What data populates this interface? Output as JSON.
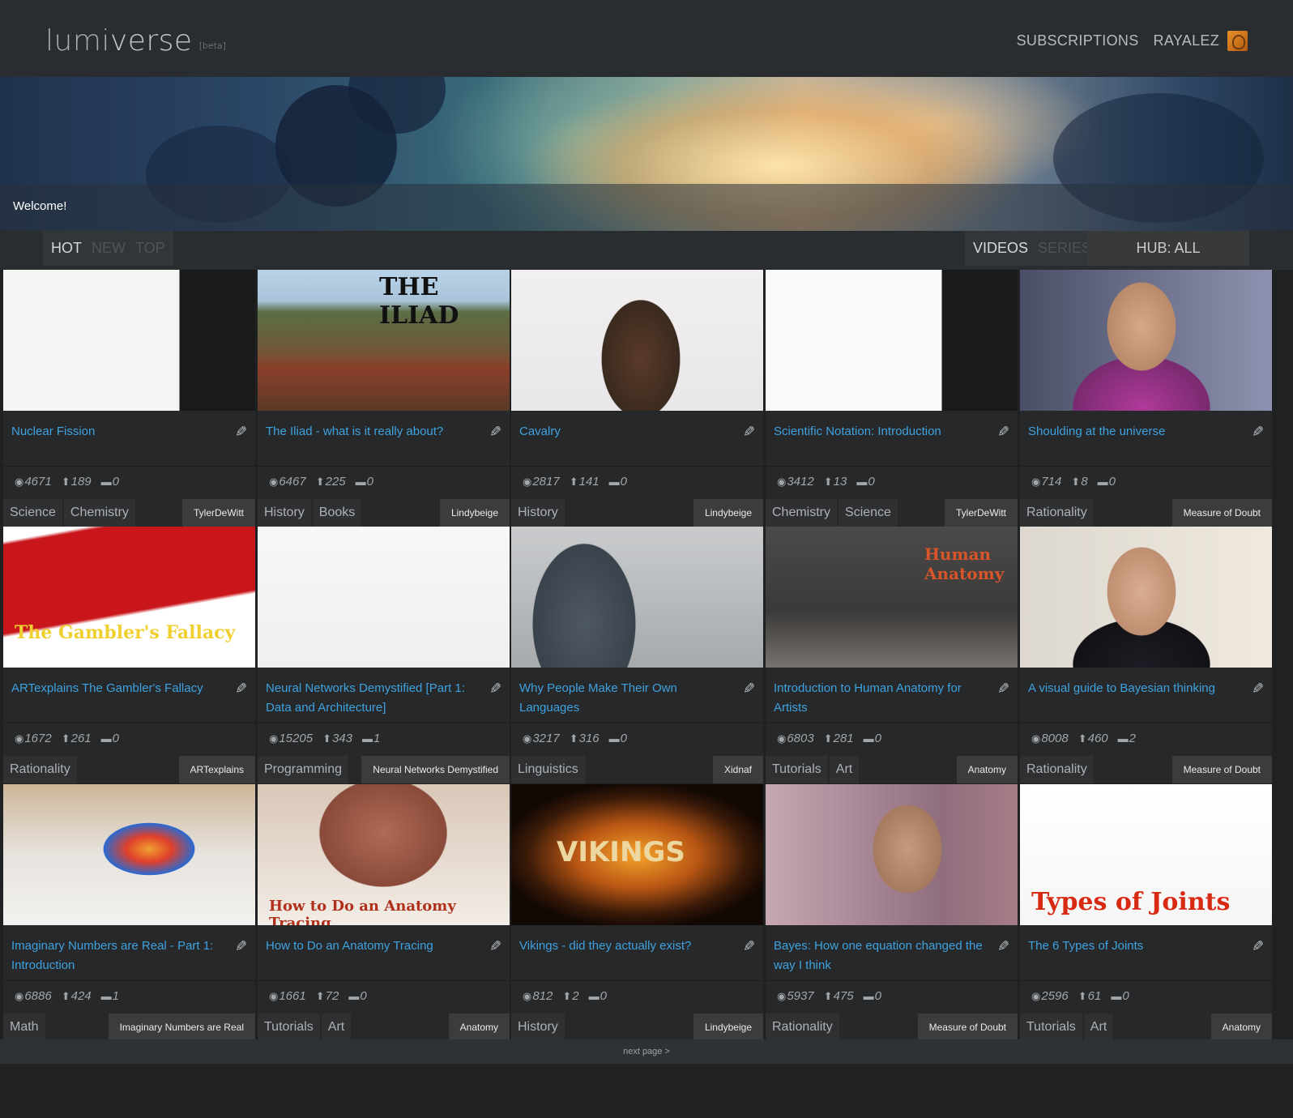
{
  "app": {
    "name_light": "lumi",
    "name_bold": "verse",
    "beta": "[beta]"
  },
  "nav": {
    "subscriptions": "SUBSCRIPTIONS",
    "user": "RAYALEZ"
  },
  "banner": {
    "welcome": "Welcome!"
  },
  "sort_tabs": [
    {
      "label": "HOT",
      "active": true
    },
    {
      "label": "NEW",
      "active": false
    },
    {
      "label": "TOP",
      "active": false
    }
  ],
  "type_tabs": [
    {
      "label": "VIDEOS",
      "active": true
    },
    {
      "label": "SERIES",
      "active": false
    }
  ],
  "hub": {
    "label": "HUB: ALL"
  },
  "colors": {
    "accent_link": "#3fa2e0",
    "header_bg": "#2a2d2f",
    "card_bg": "#262829",
    "page_bg": "#1f2123"
  },
  "cards": [
    {
      "title": "Nuclear Fission",
      "views": "4671",
      "votes": "189",
      "comments": "0",
      "tags": [
        "Science",
        "Chemistry"
      ],
      "channel": "TylerDeWitt"
    },
    {
      "title": "The Iliad - what is it really about?",
      "views": "6467",
      "votes": "225",
      "comments": "0",
      "tags": [
        "History",
        "Books"
      ],
      "channel": "Lindybeige",
      "thumb_text": "THE ILIAD"
    },
    {
      "title": "Cavalry",
      "views": "2817",
      "votes": "141",
      "comments": "0",
      "tags": [
        "History"
      ],
      "channel": "Lindybeige"
    },
    {
      "title": "Scientific Notation: Introduction",
      "views": "3412",
      "votes": "13",
      "comments": "0",
      "tags": [
        "Chemistry",
        "Science"
      ],
      "channel": "TylerDeWitt"
    },
    {
      "title": "Shoulding at the universe",
      "views": "714",
      "votes": "8",
      "comments": "0",
      "tags": [
        "Rationality"
      ],
      "channel": "Measure of Doubt"
    },
    {
      "title": "ARTexplains The Gambler's Fallacy",
      "views": "1672",
      "votes": "261",
      "comments": "0",
      "tags": [
        "Rationality"
      ],
      "channel": "ARTexplains",
      "thumb_text": "The Gambler's Fallacy"
    },
    {
      "title": "Neural Networks Demystified [Part 1: Data and Architecture]",
      "views": "15205",
      "votes": "343",
      "comments": "1",
      "tags": [
        "Programming"
      ],
      "channel": "Neural Networks Demystified"
    },
    {
      "title": "Why People Make Their Own Languages",
      "views": "3217",
      "votes": "316",
      "comments": "0",
      "tags": [
        "Linguistics"
      ],
      "channel": "Xidnaf"
    },
    {
      "title": "Introduction to Human Anatomy for Artists",
      "views": "6803",
      "votes": "281",
      "comments": "0",
      "tags": [
        "Tutorials",
        "Art"
      ],
      "channel": "Anatomy",
      "thumb_text": "Human Anatomy"
    },
    {
      "title": "A visual guide to Bayesian thinking",
      "views": "8008",
      "votes": "460",
      "comments": "2",
      "tags": [
        "Rationality"
      ],
      "channel": "Measure of Doubt"
    },
    {
      "title": "Imaginary Numbers are Real - Part 1: Introduction",
      "views": "6886",
      "votes": "424",
      "comments": "1",
      "tags": [
        "Math"
      ],
      "channel": "Imaginary Numbers are Real"
    },
    {
      "title": "How to Do an Anatomy Tracing",
      "views": "1661",
      "votes": "72",
      "comments": "0",
      "tags": [
        "Tutorials",
        "Art"
      ],
      "channel": "Anatomy",
      "thumb_text": "How to Do an Anatomy Tracing"
    },
    {
      "title": "Vikings - did they actually exist?",
      "views": "812",
      "votes": "2",
      "comments": "0",
      "tags": [
        "History"
      ],
      "channel": "Lindybeige",
      "thumb_text": "VIKINGS"
    },
    {
      "title": "Bayes: How one equation changed the way I think",
      "views": "5937",
      "votes": "475",
      "comments": "0",
      "tags": [
        "Rationality"
      ],
      "channel": "Measure of Doubt"
    },
    {
      "title": "The 6 Types of Joints",
      "views": "2596",
      "votes": "61",
      "comments": "0",
      "tags": [
        "Tutorials",
        "Art"
      ],
      "channel": "Anatomy",
      "thumb_text": "Types of Joints"
    }
  ],
  "footer": {
    "next_page": "next page >"
  }
}
